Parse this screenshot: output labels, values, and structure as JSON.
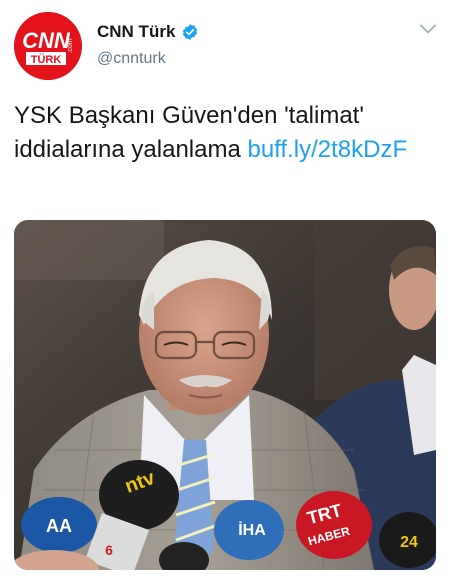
{
  "header": {
    "avatar_logo": {
      "line1": "CNN",
      "line2": "TÜRK",
      "side": ".com",
      "color": "#e3121b"
    },
    "display_name": "CNN Türk",
    "verified_icon": "verified-badge-icon",
    "handle": "@cnnturk",
    "menu_icon": "chevron-down-icon"
  },
  "tweet": {
    "text": "YSK Başkanı Güven'den 'talimat' iddialarına yalanlama ",
    "link": "buff.ly/2t8kDzF",
    "link_color": "#1da1f2"
  },
  "media": {
    "description_icon": "press-photo",
    "mic_logos": {
      "ntv": "ntv",
      "aa": "AA",
      "ihlas": "İHA",
      "trt_line1": "TRT",
      "trt_line2": "HABER",
      "news_channel": "6",
      "right_mic": "24"
    }
  }
}
